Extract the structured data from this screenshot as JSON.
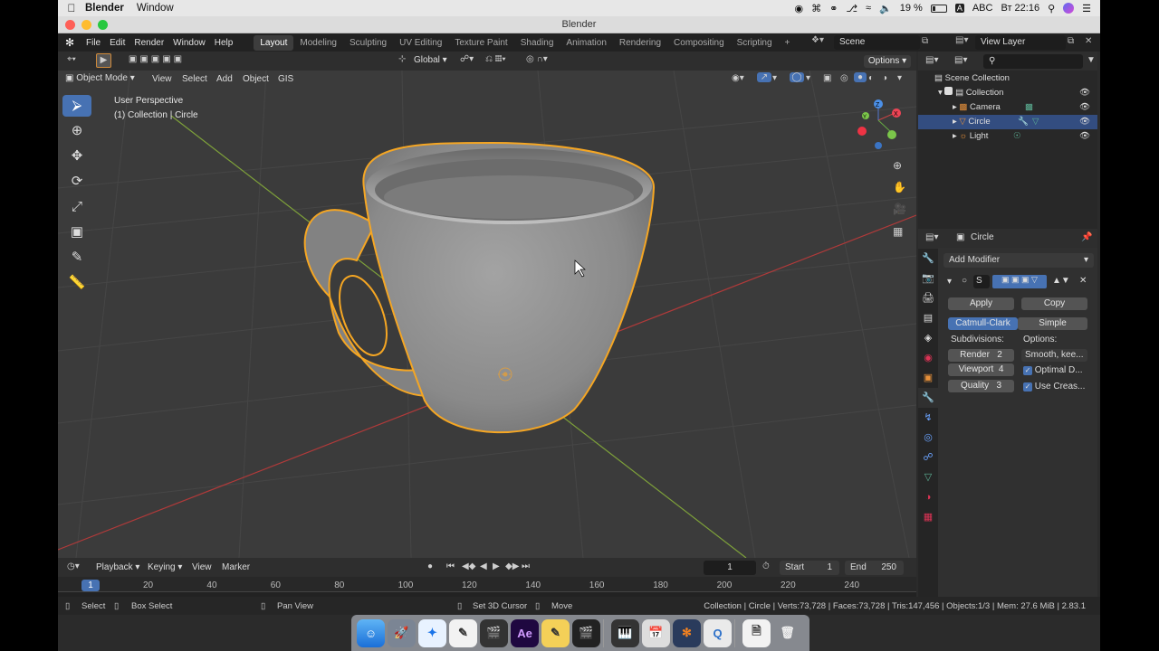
{
  "mac_menubar": {
    "app": "Blender",
    "menus": [
      "Window"
    ],
    "battery": "19 %",
    "keyboard": "ABC",
    "clock": "Вт 22:16"
  },
  "window": {
    "title": "Blender"
  },
  "topbar": {
    "menus": [
      "File",
      "Edit",
      "Render",
      "Window",
      "Help"
    ],
    "workspaces": [
      "Layout",
      "Modeling",
      "Sculpting",
      "UV Editing",
      "Texture Paint",
      "Shading",
      "Animation",
      "Rendering",
      "Compositing",
      "Scripting"
    ],
    "active_workspace": "Layout",
    "scene": "Scene",
    "view_layer": "View Layer"
  },
  "tool_header": {
    "orientation": "Global",
    "options": "Options"
  },
  "viewport_header": {
    "mode": "Object Mode",
    "menus": [
      "View",
      "Select",
      "Add",
      "Object",
      "GIS"
    ]
  },
  "viewport": {
    "perspective_label": "User Perspective",
    "collection_label": "(1) Collection | Circle"
  },
  "outliner": {
    "root": "Scene Collection",
    "items": [
      {
        "name": "Collection",
        "level": 1
      },
      {
        "name": "Camera",
        "level": 2
      },
      {
        "name": "Circle",
        "level": 2,
        "selected": true
      },
      {
        "name": "Light",
        "level": 2
      }
    ]
  },
  "properties": {
    "object_name": "Circle",
    "add_modifier": "Add Modifier",
    "modifier_name": "S",
    "apply": "Apply",
    "copy": "Copy",
    "catmull": "Catmull-Clark",
    "simple": "Simple",
    "subdivisions_label": "Subdivisions:",
    "options_label": "Options:",
    "render_label": "Render",
    "render_value": "2",
    "viewport_label": "Viewport",
    "viewport_value": "4",
    "quality_label": "Quality",
    "quality_value": "3",
    "uv_smooth": "Smooth, kee...",
    "optimal_display": "Optimal D...",
    "use_creases": "Use Creas..."
  },
  "timeline": {
    "menus": [
      "Playback",
      "Keying",
      "View",
      "Marker"
    ],
    "current_frame": "1",
    "start_label": "Start",
    "start": "1",
    "end_label": "End",
    "end": "250",
    "ruler_marker": "1",
    "ruler": [
      "20",
      "40",
      "60",
      "80",
      "100",
      "120",
      "140",
      "160",
      "180",
      "200",
      "220",
      "240"
    ]
  },
  "statusbar": {
    "select": "Select",
    "box_select": "Box Select",
    "pan_view": "Pan View",
    "set_cursor": "Set 3D Cursor",
    "move": "Move",
    "stats": "Collection | Circle | Verts:73,728 | Faces:73,728 | Tris:147,456 | Objects:1/3 | Mem: 27.6 MiB | 2.83.1"
  },
  "colors": {
    "accent": "#4772b3",
    "selection_outline": "#f5a623",
    "x_axis": "#b03a3a",
    "y_axis": "#7ea13a"
  }
}
